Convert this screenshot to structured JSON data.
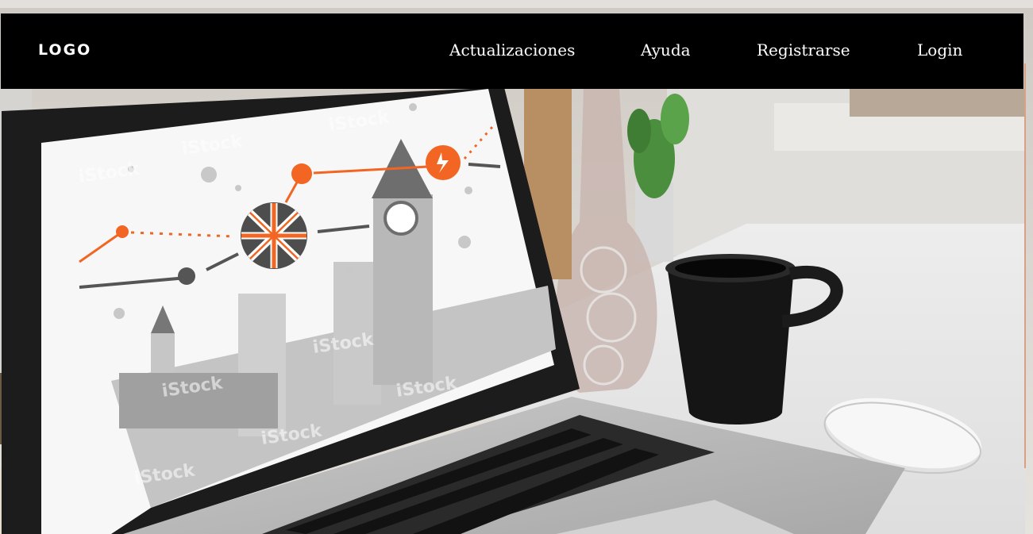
{
  "nav": {
    "logo": "LOGO",
    "links": [
      {
        "label": "Actualizaciones"
      },
      {
        "label": "Ayuda"
      },
      {
        "label": "Registrarse"
      },
      {
        "label": "Login"
      }
    ]
  },
  "hero": {
    "watermark": "iStock",
    "scene": "laptop-coffee-desk-photo"
  },
  "colors": {
    "navbar_bg": "#000000",
    "nav_text": "#ffffff",
    "accent_orange": "#f26522"
  }
}
